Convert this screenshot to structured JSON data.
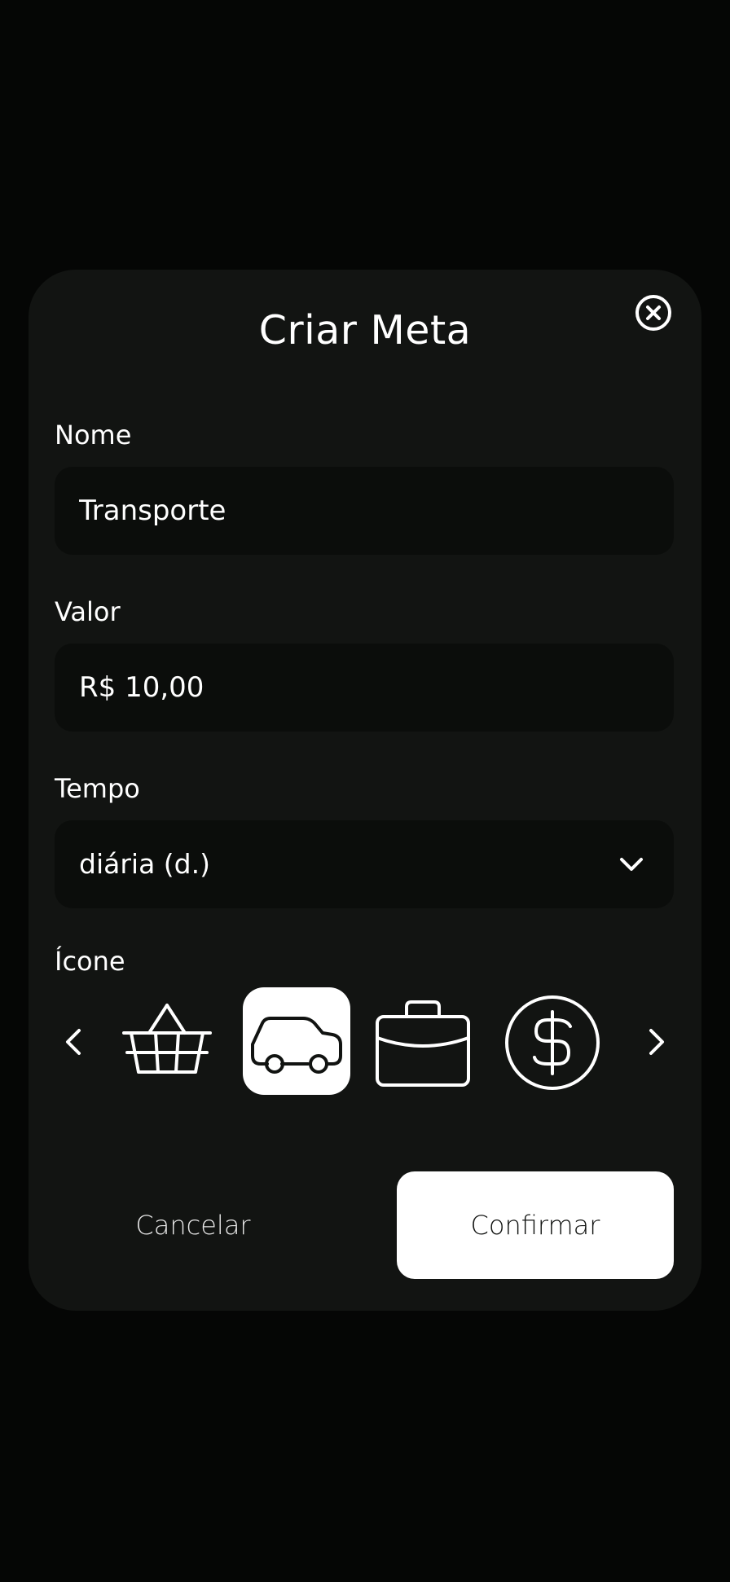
{
  "modal": {
    "title": "Criar Meta"
  },
  "fields": {
    "nome": {
      "label": "Nome",
      "value": "Transporte"
    },
    "valor": {
      "label": "Valor",
      "value": "R$ 10,00"
    },
    "tempo": {
      "label": "Tempo",
      "selected": "diária (d.)"
    }
  },
  "icon_picker": {
    "label": "Ícone",
    "options": [
      {
        "icon": "basket-icon",
        "selected": false
      },
      {
        "icon": "car-icon",
        "selected": true
      },
      {
        "icon": "briefcase-icon",
        "selected": false
      },
      {
        "icon": "dollar-circle-icon",
        "selected": false
      }
    ]
  },
  "actions": {
    "cancel_label": "Cancelar",
    "confirm_label": "Confirmar"
  },
  "colors": {
    "background": "#050605",
    "modal": "#121412",
    "field": "#0b0d0b",
    "accent": "#ffffff"
  }
}
